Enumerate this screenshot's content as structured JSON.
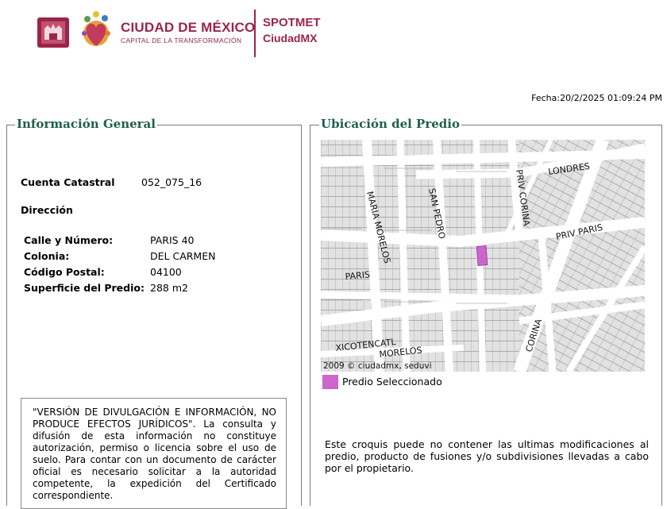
{
  "header": {
    "brand_title": "CIUDAD DE MÉXICO",
    "brand_subtitle": "CAPITAL DE LA TRANSFORMACIÓN",
    "app_name_line1": "SPOTMET",
    "app_name_line2": "CiudadMX",
    "brand_color": "#9d2449"
  },
  "fecha": "Fecha:20/2/2025 01:09:24 PM",
  "info_general": {
    "title": "Información General",
    "cuenta_label": "Cuenta Catastral",
    "cuenta_value": "052_075_16",
    "direccion_label": "Dirección",
    "fields": [
      {
        "label": "Calle y Número:",
        "value": "PARIS 40"
      },
      {
        "label": "Colonia:",
        "value": "DEL CARMEN"
      },
      {
        "label": "Código Postal:",
        "value": "04100"
      },
      {
        "label": "Superficie del Predio:",
        "value": "288 m2"
      }
    ],
    "notice": "\"VERSIÓN DE DIVULGACIÓN E INFORMACIÓN, NO PRODUCE EFECTOS JURÍDICOS\". La consulta y difusión de esta información no constituye autorización, permiso o licencia sobre el uso de suelo. Para contar con un documento de carácter oficial es necesario solicitar a la autoridad competente, la expedición del Certificado correspondiente."
  },
  "ubicacion": {
    "title": "Ubicación del Predio",
    "map_credit": "2009 © ciudadmx, seduvi",
    "street_labels": {
      "londres": "LONDRES",
      "priv_corina": "PRIV CORINA",
      "san_pedro": "SAN PEDRO",
      "maria_morelos": "MARIA MORELOS",
      "priv_paris": "PRIV PARIS",
      "paris": "PARIS",
      "xicotencatl": "XICOTENCATL",
      "morelos": "MORELOS",
      "corina": "CORINA"
    },
    "legend_label": "Predio Seleccionado",
    "legend_color": "#cc66cc",
    "disclaimer": "Este croquis puede no contener las ultimas modificaciones al predio, producto de fusiones y/o subdivisiones llevadas a cabo por el propietario."
  }
}
